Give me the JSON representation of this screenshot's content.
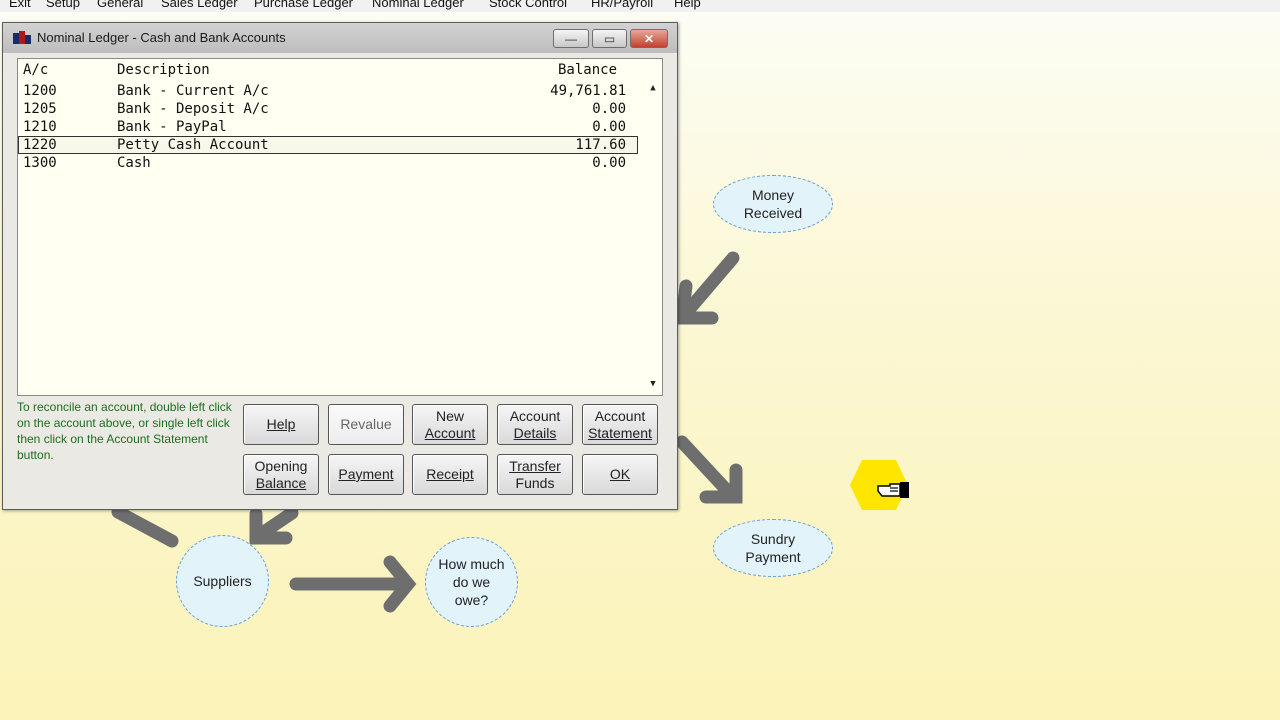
{
  "menu": [
    "Exit",
    "Setup",
    "General",
    "Sales Ledger",
    "Purchase Ledger",
    "Nominal Ledger",
    "Stock Control",
    "HR/Payroll",
    "Help"
  ],
  "window": {
    "title": "Nominal Ledger - Cash and Bank Accounts",
    "min_glyph": "—",
    "max_glyph": "▭",
    "close_glyph": "✕"
  },
  "table": {
    "headers": {
      "ac": "A/c",
      "description": "Description",
      "balance": "Balance"
    },
    "rows": [
      {
        "ac": "1200",
        "description": "Bank - Current A/c",
        "balance": "49,761.81"
      },
      {
        "ac": "1205",
        "description": "Bank - Deposit A/c",
        "balance": "0.00"
      },
      {
        "ac": "1210",
        "description": "Bank - PayPal",
        "balance": "0.00"
      },
      {
        "ac": "1220",
        "description": "Petty Cash Account",
        "balance": "117.60"
      },
      {
        "ac": "1300",
        "description": "Cash",
        "balance": "0.00"
      }
    ],
    "selected_row": "1220",
    "scroll_up": "▲",
    "scroll_down": "▼"
  },
  "hint": "To reconcile an account, double left click on the account above, or single left click then click on the Account Statement button.",
  "buttons": {
    "help": "Help",
    "revalue": "Revalue",
    "new_account": [
      "New",
      "Account"
    ],
    "account_details": [
      "Account",
      "Details"
    ],
    "account_statement": [
      "Account",
      "Statement"
    ],
    "opening_balance": [
      "Opening",
      "Balance"
    ],
    "payment": "Payment",
    "receipt": "Receipt",
    "transfer_funds": [
      "Transfer",
      "Funds"
    ],
    "ok": "OK"
  },
  "diagram": {
    "money_received": [
      "Money",
      "Received"
    ],
    "sundry_payment": [
      "Sundry",
      "Payment"
    ],
    "suppliers": "Suppliers",
    "how_much": [
      "How much",
      "do we",
      "owe?"
    ]
  },
  "colors": {
    "bubble_fill": "#e2f3f9",
    "bubble_border": "#6a9ec8",
    "arrow": "#6e6e6e",
    "hint_text": "#1f6d1f",
    "cursor_highlight": "#ffe600"
  }
}
